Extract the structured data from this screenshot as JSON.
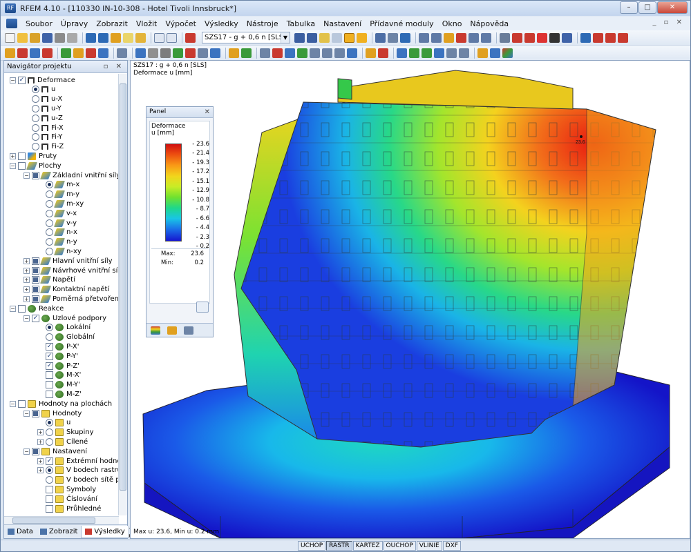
{
  "window": {
    "title": "RFEM 4.10 - [110330 IN-10-308 - Hotel Tivoli Innsbruck*]",
    "app_badge": "RF",
    "minimize": "–",
    "maximize": "□",
    "close": "✕",
    "mdi_controls": "_ ▫ ✕"
  },
  "menubar": {
    "items": [
      "Soubor",
      "Úpravy",
      "Zobrazit",
      "Vložit",
      "Výpočet",
      "Výsledky",
      "Nástroje",
      "Tabulka",
      "Nastavení",
      "Přídavné moduly",
      "Okno",
      "Nápověda"
    ]
  },
  "toolbar": {
    "load_case": "SZS17 - g + 0,6 n [SLS]"
  },
  "navigator": {
    "title": "Navigátor projektu",
    "header_buttons": "▫ ✕",
    "tree": [
      {
        "label": "Deformace",
        "level": 0,
        "exp": "−",
        "box": "check",
        "icon": "deform"
      },
      {
        "label": "u",
        "level": 1,
        "box": "radio-on",
        "icon": "deform"
      },
      {
        "label": "u-X",
        "level": 1,
        "box": "radio",
        "icon": "deform"
      },
      {
        "label": "u-Y",
        "level": 1,
        "box": "radio",
        "icon": "deform"
      },
      {
        "label": "u-Z",
        "level": 1,
        "box": "radio",
        "icon": "deform"
      },
      {
        "label": "Fi-X",
        "level": 1,
        "box": "radio",
        "icon": "deform"
      },
      {
        "label": "Fi-Y",
        "level": 1,
        "box": "radio",
        "icon": "deform"
      },
      {
        "label": "Fi-Z",
        "level": 1,
        "box": "radio",
        "icon": "deform"
      },
      {
        "label": "Pruty",
        "level": 0,
        "exp": "+",
        "box": "empty",
        "icon": "member"
      },
      {
        "label": "Plochy",
        "level": 0,
        "exp": "−",
        "box": "empty",
        "icon": "plate"
      },
      {
        "label": "Základní vnitřní síly",
        "level": 1,
        "exp": "−",
        "box": "partial",
        "icon": "plate"
      },
      {
        "label": "m-x",
        "level": 2,
        "box": "radio-on",
        "icon": "plate"
      },
      {
        "label": "m-y",
        "level": 2,
        "box": "radio",
        "icon": "plate"
      },
      {
        "label": "m-xy",
        "level": 2,
        "box": "radio",
        "icon": "plate"
      },
      {
        "label": "v-x",
        "level": 2,
        "box": "radio",
        "icon": "plate"
      },
      {
        "label": "v-y",
        "level": 2,
        "box": "radio",
        "icon": "plate"
      },
      {
        "label": "n-x",
        "level": 2,
        "box": "radio",
        "icon": "plate"
      },
      {
        "label": "n-y",
        "level": 2,
        "box": "radio",
        "icon": "plate"
      },
      {
        "label": "n-xy",
        "level": 2,
        "box": "radio",
        "icon": "plate"
      },
      {
        "label": "Hlavní vnitřní síly",
        "level": 1,
        "exp": "+",
        "box": "partial",
        "icon": "plate"
      },
      {
        "label": "Návrhové vnitřní síly",
        "level": 1,
        "exp": "+",
        "box": "partial",
        "icon": "plate"
      },
      {
        "label": "Napětí",
        "level": 1,
        "exp": "+",
        "box": "partial",
        "icon": "plate"
      },
      {
        "label": "Kontaktní napětí",
        "level": 1,
        "exp": "+",
        "box": "partial",
        "icon": "plate"
      },
      {
        "label": "Poměrná přetvoření",
        "level": 1,
        "exp": "+",
        "box": "partial",
        "icon": "plate"
      },
      {
        "label": "Reakce",
        "level": 0,
        "exp": "−",
        "box": "empty",
        "icon": "support"
      },
      {
        "label": "Uzlové podpory",
        "level": 1,
        "exp": "−",
        "box": "check",
        "icon": "support"
      },
      {
        "label": "Lokální",
        "level": 2,
        "box": "radio-on",
        "icon": "support"
      },
      {
        "label": "Globální",
        "level": 2,
        "box": "radio",
        "icon": "support"
      },
      {
        "label": "P-X'",
        "level": 2,
        "box": "check",
        "icon": "support"
      },
      {
        "label": "P-Y'",
        "level": 2,
        "box": "check",
        "icon": "support"
      },
      {
        "label": "P-Z'",
        "level": 2,
        "box": "check",
        "icon": "support"
      },
      {
        "label": "M-X'",
        "level": 2,
        "box": "empty",
        "icon": "support"
      },
      {
        "label": "M-Y'",
        "level": 2,
        "box": "empty",
        "icon": "support"
      },
      {
        "label": "M-Z'",
        "level": 2,
        "box": "empty",
        "icon": "support"
      },
      {
        "label": "Hodnoty na plochách",
        "level": 0,
        "exp": "−",
        "box": "empty",
        "icon": "values"
      },
      {
        "label": "Hodnoty",
        "level": 1,
        "exp": "−",
        "box": "partial",
        "icon": "values"
      },
      {
        "label": "u",
        "level": 2,
        "box": "radio-on",
        "icon": "values"
      },
      {
        "label": "Skupiny",
        "level": 2,
        "exp": "+",
        "box": "radio",
        "icon": "values"
      },
      {
        "label": "Cílené",
        "level": 2,
        "exp": "+",
        "box": "radio",
        "icon": "values"
      },
      {
        "label": "Nastavení",
        "level": 1,
        "exp": "−",
        "box": "partial",
        "icon": "values"
      },
      {
        "label": "Extrémní hodnoty",
        "level": 2,
        "exp": "+",
        "box": "check",
        "icon": "values"
      },
      {
        "label": "V bodech rastru a ru",
        "level": 2,
        "exp": "+",
        "box": "radio-on",
        "icon": "values"
      },
      {
        "label": "V bodech sítě prvků",
        "level": 2,
        "box": "radio",
        "icon": "values"
      },
      {
        "label": "Symboly",
        "level": 2,
        "box": "empty",
        "icon": "values"
      },
      {
        "label": "Číslování",
        "level": 2,
        "box": "empty",
        "icon": "values"
      },
      {
        "label": "Průhledné",
        "level": 2,
        "box": "empty",
        "icon": "values"
      }
    ],
    "tabs": [
      "Data",
      "Zobrazit",
      "Výsledky"
    ],
    "tab_arrows": "◂ ▸"
  },
  "viewport": {
    "line1": "SZS17 : g + 0,6 n [SLS]",
    "line2": "Deformace u [mm]",
    "footer": "Max u: 23.6, Min u: 0.2 mm",
    "max_marker": "23.6"
  },
  "panel": {
    "title": "Panel",
    "close": "✕",
    "heading1": "Deformace",
    "heading2": "u [mm]",
    "scale": [
      "23.6",
      "21.4",
      "19.3",
      "17.2",
      "15.1",
      "12.9",
      "10.8",
      "8.7",
      "6.6",
      "4.4",
      "2.3",
      "0.2"
    ],
    "max_label": "Max:",
    "max_value": "23.6",
    "min_label": "Min:",
    "min_value": "0.2"
  },
  "statusbar": {
    "buttons": [
      "UCHOP",
      "RASTR",
      "KARTEZ",
      "OUCHOP",
      "VLINIE",
      "DXF"
    ],
    "active": "RASTR"
  }
}
